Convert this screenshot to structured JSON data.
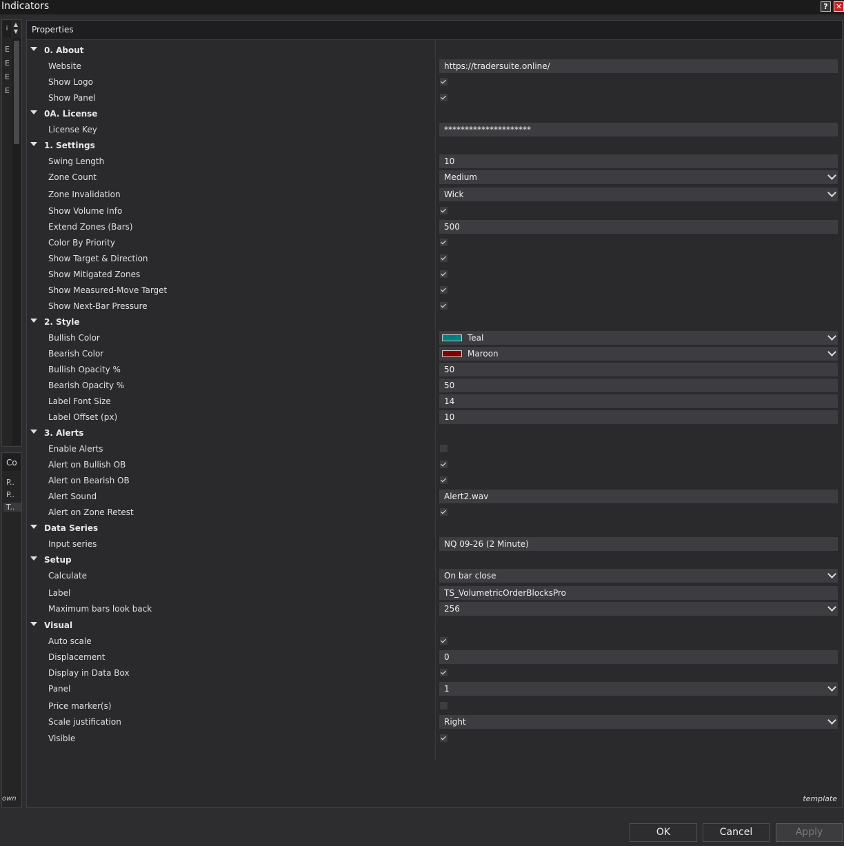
{
  "window": {
    "title": "Indicators",
    "help_label": "?",
    "close_label": "✕"
  },
  "left_panel": {
    "top_label": "i",
    "items": [
      "Ε",
      "Ε",
      "Ε",
      "Ε"
    ],
    "config_header": "Co",
    "config_items": [
      "P..",
      "P..",
      "T.."
    ],
    "footer": "own"
  },
  "properties": {
    "title": "Properties",
    "template_label": "template"
  },
  "categories": [
    {
      "name": "0. About",
      "rows": [
        {
          "label": "Website",
          "type": "text",
          "value": "https://tradersuite.online/"
        },
        {
          "label": "Show Logo",
          "type": "check",
          "checked": true
        },
        {
          "label": "Show Panel",
          "type": "check",
          "checked": true
        }
      ]
    },
    {
      "name": "0A. License",
      "rows": [
        {
          "label": "License Key",
          "type": "text",
          "value": "*********************"
        }
      ]
    },
    {
      "name": "1. Settings",
      "rows": [
        {
          "label": "Swing Length",
          "type": "text",
          "value": "10"
        },
        {
          "label": "Zone Count",
          "type": "select",
          "value": "Medium"
        },
        {
          "label": "Zone Invalidation",
          "type": "select",
          "value": "Wick"
        },
        {
          "label": "Show Volume Info",
          "type": "check",
          "checked": true
        },
        {
          "label": "Extend Zones (Bars)",
          "type": "text",
          "value": "500"
        },
        {
          "label": "Color By Priority",
          "type": "check",
          "checked": true
        },
        {
          "label": "Show Target & Direction",
          "type": "check",
          "checked": true
        },
        {
          "label": "Show Mitigated Zones",
          "type": "check",
          "checked": true
        },
        {
          "label": "Show Measured-Move Target",
          "type": "check",
          "checked": true
        },
        {
          "label": "Show Next-Bar Pressure",
          "type": "check",
          "checked": true
        }
      ]
    },
    {
      "name": "2. Style",
      "rows": [
        {
          "label": "Bullish Color",
          "type": "color",
          "value": "Teal",
          "color": "#008080"
        },
        {
          "label": "Bearish Color",
          "type": "color",
          "value": "Maroon",
          "color": "#800000"
        },
        {
          "label": "Bullish Opacity %",
          "type": "text",
          "value": "50"
        },
        {
          "label": "Bearish Opacity %",
          "type": "text",
          "value": "50"
        },
        {
          "label": "Label Font Size",
          "type": "text",
          "value": "14"
        },
        {
          "label": "Label Offset (px)",
          "type": "text",
          "value": "10"
        }
      ]
    },
    {
      "name": "3. Alerts",
      "rows": [
        {
          "label": "Enable Alerts",
          "type": "check",
          "checked": false
        },
        {
          "label": "Alert on Bullish OB",
          "type": "check",
          "checked": true
        },
        {
          "label": "Alert on Bearish OB",
          "type": "check",
          "checked": true
        },
        {
          "label": "Alert Sound",
          "type": "text",
          "value": "Alert2.wav"
        },
        {
          "label": "Alert on Zone Retest",
          "type": "check",
          "checked": true
        }
      ]
    },
    {
      "name": "Data Series",
      "rows": [
        {
          "label": "Input series",
          "type": "text",
          "value": "NQ 09-26 (2 Minute)"
        }
      ]
    },
    {
      "name": "Setup",
      "rows": [
        {
          "label": "Calculate",
          "type": "select",
          "value": "On bar close"
        },
        {
          "label": "Label",
          "type": "text",
          "value": "TS_VolumetricOrderBlocksPro"
        },
        {
          "label": "Maximum bars look back",
          "type": "select",
          "value": "256"
        }
      ]
    },
    {
      "name": "Visual",
      "rows": [
        {
          "label": "Auto scale",
          "type": "check",
          "checked": true
        },
        {
          "label": "Displacement",
          "type": "text",
          "value": "0"
        },
        {
          "label": "Display in Data Box",
          "type": "check",
          "checked": true
        },
        {
          "label": "Panel",
          "type": "select",
          "value": "1"
        },
        {
          "label": "Price marker(s)",
          "type": "check",
          "checked": false
        },
        {
          "label": "Scale justification",
          "type": "select",
          "value": "Right"
        },
        {
          "label": "Visible",
          "type": "check",
          "checked": true
        }
      ]
    }
  ],
  "buttons": {
    "ok": "OK",
    "cancel": "Cancel",
    "apply": "Apply"
  }
}
